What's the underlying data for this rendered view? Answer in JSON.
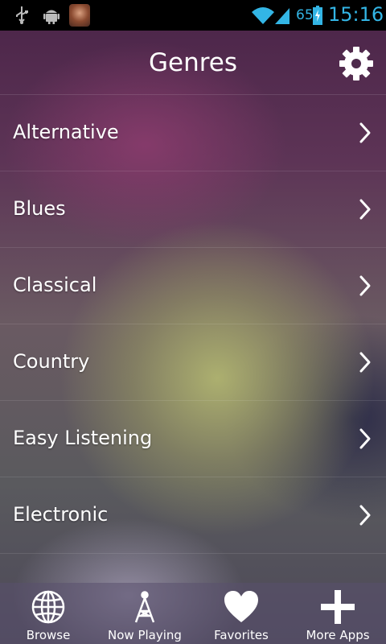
{
  "status_bar": {
    "battery_percent": "65",
    "time": "15:16",
    "icons": [
      "usb-icon",
      "android-debug-icon",
      "notification-thumbnail",
      "wifi-icon",
      "signal-icon",
      "battery-icon"
    ]
  },
  "header": {
    "title": "Genres",
    "settings_icon": "gear-icon"
  },
  "genres": [
    {
      "label": "Alternative"
    },
    {
      "label": "Blues"
    },
    {
      "label": "Classical"
    },
    {
      "label": "Country"
    },
    {
      "label": "Easy Listening"
    },
    {
      "label": "Electronic"
    }
  ],
  "tabs": [
    {
      "label": "Browse",
      "icon": "globe-icon"
    },
    {
      "label": "Now Playing",
      "icon": "antenna-icon"
    },
    {
      "label": "Favorites",
      "icon": "heart-icon"
    },
    {
      "label": "More Apps",
      "icon": "plus-icon"
    }
  ],
  "colors": {
    "status_accent": "#33b5e5",
    "text": "#ffffff"
  }
}
